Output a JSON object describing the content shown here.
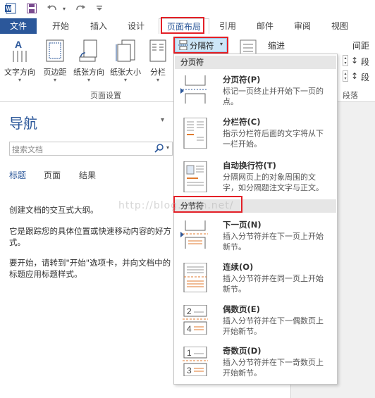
{
  "tabs": [
    "文件",
    "开始",
    "插入",
    "设计",
    "页面布局",
    "引用",
    "邮件",
    "审阅",
    "视图"
  ],
  "ribbon": {
    "buttons": [
      "文字方向",
      "页边距",
      "纸张方向",
      "纸张大小",
      "分栏"
    ],
    "breaks_button": "分隔符",
    "indent_label": "缩进",
    "spacing_label": "间距",
    "para_partial": "段",
    "group_page_setup": "页面设置",
    "group_paragraph": "段落"
  },
  "nav": {
    "title": "导航",
    "search_placeholder": "搜索文档",
    "tabs": [
      "标题",
      "页面",
      "结果"
    ],
    "lines": [
      "创建文档的交互式大纲。",
      "它是跟踪您的具体位置或快速移动内容的好方",
      "式。",
      "要开始，请转到\"开始\"选项卡，并向文档中的",
      "标题应用标题样式。"
    ]
  },
  "dropdown": {
    "section_page": "分页符",
    "section_section": "分节符",
    "items": [
      {
        "title": "分页符(P)",
        "d1": "标记一页终止并开始下一页的",
        "d2": "点。"
      },
      {
        "title": "分栏符(C)",
        "d1": "指示分栏符后面的文字将从下",
        "d2": "一栏开始。"
      },
      {
        "title": "自动换行符(T)",
        "d1": "分隔网页上的对象周围的文",
        "d2": "字，如分隔题注文字与正文。"
      },
      {
        "title": "下一页(N)",
        "d1": "插入分节符并在下一页上开始",
        "d2": "新节。"
      },
      {
        "title": "连续(O)",
        "d1": "插入分节符并在同一页上开始",
        "d2": "新节。"
      },
      {
        "title": "偶数页(E)",
        "d1": "插入分节符并在下一偶数页上",
        "d2": "开始新节。"
      },
      {
        "title": "奇数页(D)",
        "d1": "插入分节符并在下一奇数页上",
        "d2": "开始新节。"
      }
    ]
  },
  "watermark": "http://blog.csdn.net/"
}
